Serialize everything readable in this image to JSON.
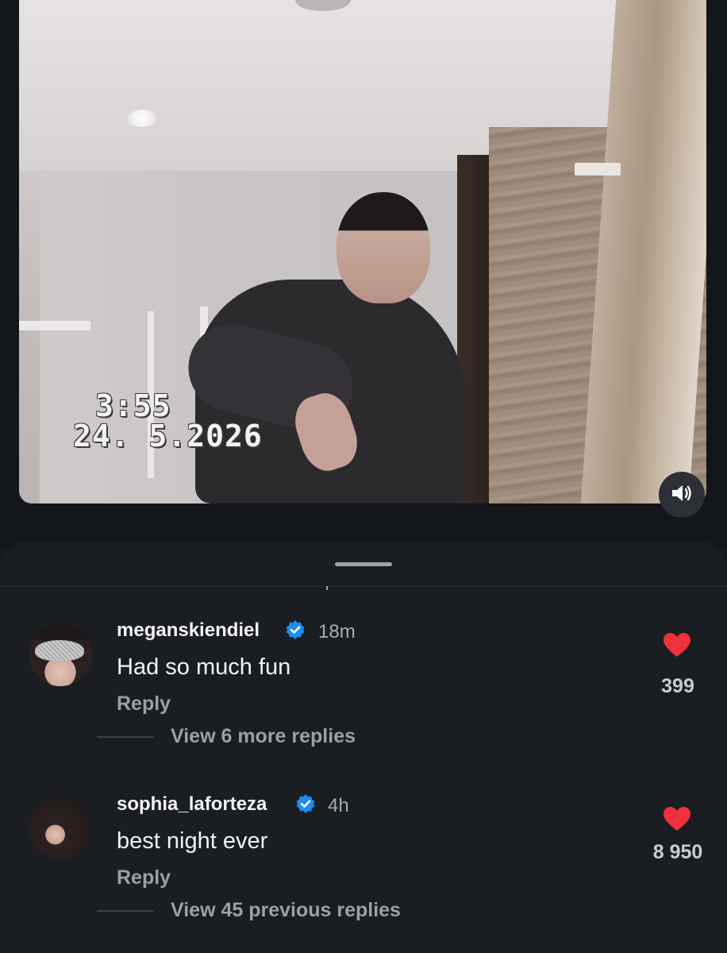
{
  "video": {
    "timestamp_time": "3:55",
    "timestamp_date": "24. 5.2026",
    "sound_icon": "speaker-icon"
  },
  "comments": [
    {
      "username": "meganskiendiel",
      "time": "18m",
      "text": "Had so much fun",
      "reply_label": "Reply",
      "likes": "399",
      "view_more": "View 6 more replies"
    },
    {
      "username": "sophia_laforteza",
      "time": "4h",
      "text": "best night ever",
      "reply_label": "Reply",
      "likes": "8 950",
      "view_more": "View 45 previous replies"
    }
  ],
  "colors": {
    "background": "#16191d",
    "sheet": "#1a1d21",
    "heart": "#f0303d",
    "verified": "#1d8cf0"
  }
}
